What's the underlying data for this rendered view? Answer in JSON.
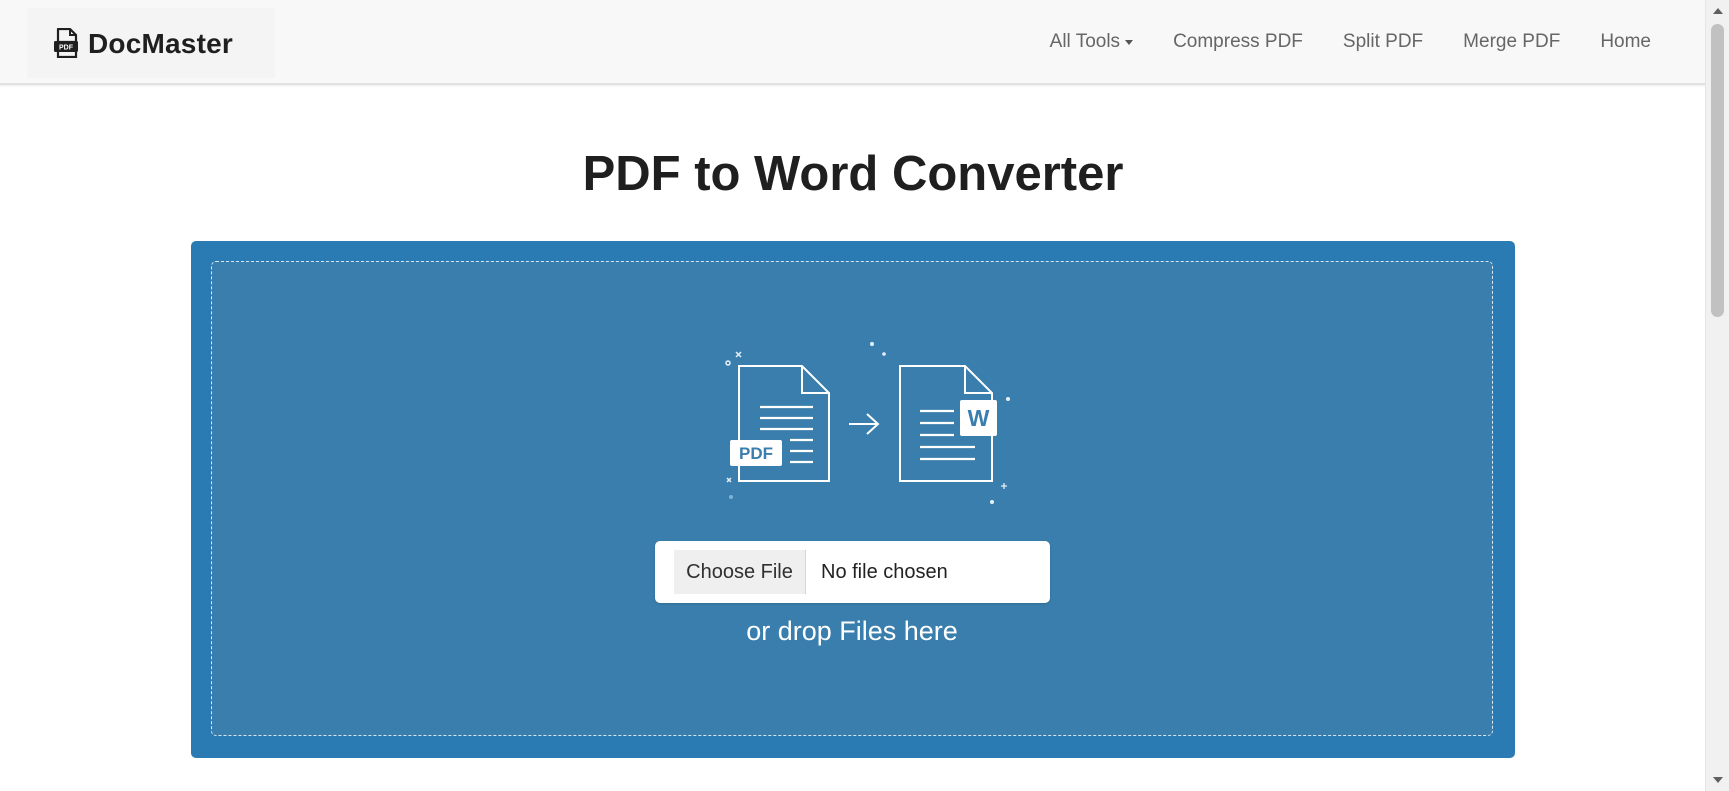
{
  "brand": {
    "name": "DocMaster",
    "icon": "file-pdf-icon"
  },
  "nav": {
    "items": [
      {
        "label": "All Tools",
        "has_dropdown": true
      },
      {
        "label": "Compress PDF"
      },
      {
        "label": "Split PDF"
      },
      {
        "label": "Merge PDF"
      },
      {
        "label": "Home"
      }
    ]
  },
  "main": {
    "title": "PDF to Word Converter",
    "upload": {
      "illustration": {
        "pdf_badge": "PDF",
        "word_badge": "W",
        "icon": "pdf-to-word-illustration"
      },
      "choose_label": "Choose File",
      "file_status": "No file chosen",
      "drop_hint": "or drop Files here"
    }
  },
  "colors": {
    "panel": "#2a7ab3",
    "drop_zone": "#397eac",
    "navbar": "#f8f8f8",
    "title": "#1f1f1f"
  }
}
